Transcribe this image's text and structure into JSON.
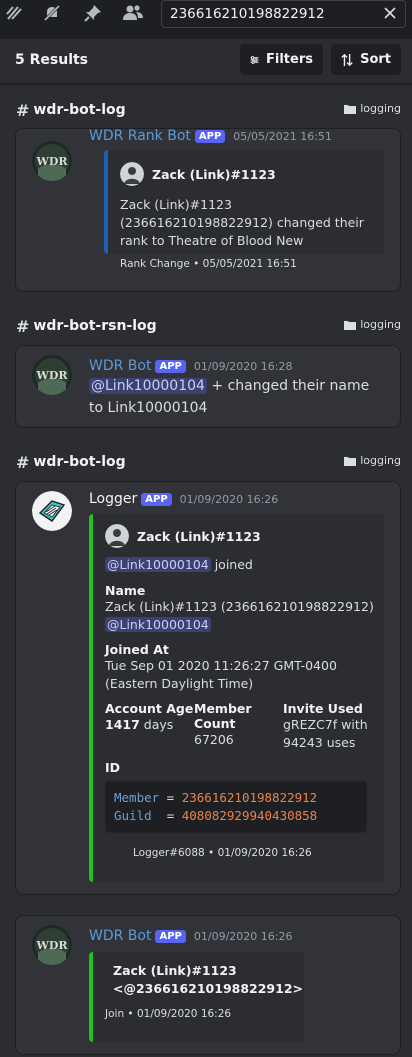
{
  "toolbar": {
    "icons": [
      "threads-icon",
      "mute-notifications-icon",
      "pin-icon",
      "members-icon"
    ],
    "search_value": "236616210198822912"
  },
  "results": {
    "count_label": "5 Results",
    "filters_label": "Filters",
    "sort_label": "Sort"
  },
  "groups": [
    {
      "channel": "wdr-bot-log",
      "category": "logging",
      "message": {
        "author": "WDR Rank Bot",
        "badge": "APP",
        "time": "05/05/2021 16:51",
        "embed": {
          "color": "#1e5fb8",
          "author": "Zack (Link)#1123",
          "description": "Zack (Link)#1123 (236616210198822912) changed their rank to Theatre of Blood New",
          "footer": "Rank Change • 05/05/2021 16:51"
        }
      }
    },
    {
      "channel": "wdr-bot-rsn-log",
      "category": "logging",
      "message": {
        "author": "WDR Bot",
        "badge": "APP",
        "time": "01/09/2020 16:28",
        "mention": "@Link10000104",
        "text": " + changed their name to Link10000104"
      }
    },
    {
      "channel": "wdr-bot-log",
      "category": "logging",
      "message": {
        "author": "Logger",
        "badge": "APP",
        "time": "01/09/2020 16:26",
        "embed": {
          "color": "#23c11f",
          "author": "Zack (Link)#1123",
          "mention": "@Link10000104",
          "mention_suffix": " joined",
          "name_title": "Name",
          "name_value": "Zack (Link)#1123 (236616210198822912)",
          "name_mention": "@Link10000104",
          "joined_title": "Joined At",
          "joined_value": "Tue Sep 01 2020 11:26:27 GMT-0400 (Eastern Daylight Time)",
          "age_title": "Account Age",
          "age_number": "1417",
          "age_unit": " days",
          "count_title": "Member Count",
          "count_value": "67206",
          "invite_title": "Invite Used",
          "invite_value": "gREZC7f with 94243 uses",
          "id_title": "ID",
          "code_member_key": "Member",
          "code_member_val": "236616210198822912",
          "code_guild_key": "Guild",
          "code_guild_val": "408082929940430858",
          "footer": "Logger#6088 • 01/09/2020 16:26"
        }
      }
    },
    {
      "message": {
        "author": "WDR Bot",
        "badge": "APP",
        "time": "01/09/2020 16:26",
        "embed": {
          "color": "#23c11f",
          "author": "Zack (Link)#1123",
          "author_line2": "<@236616210198822912>",
          "footer": "Join • 01/09/2020 16:26"
        }
      }
    }
  ]
}
